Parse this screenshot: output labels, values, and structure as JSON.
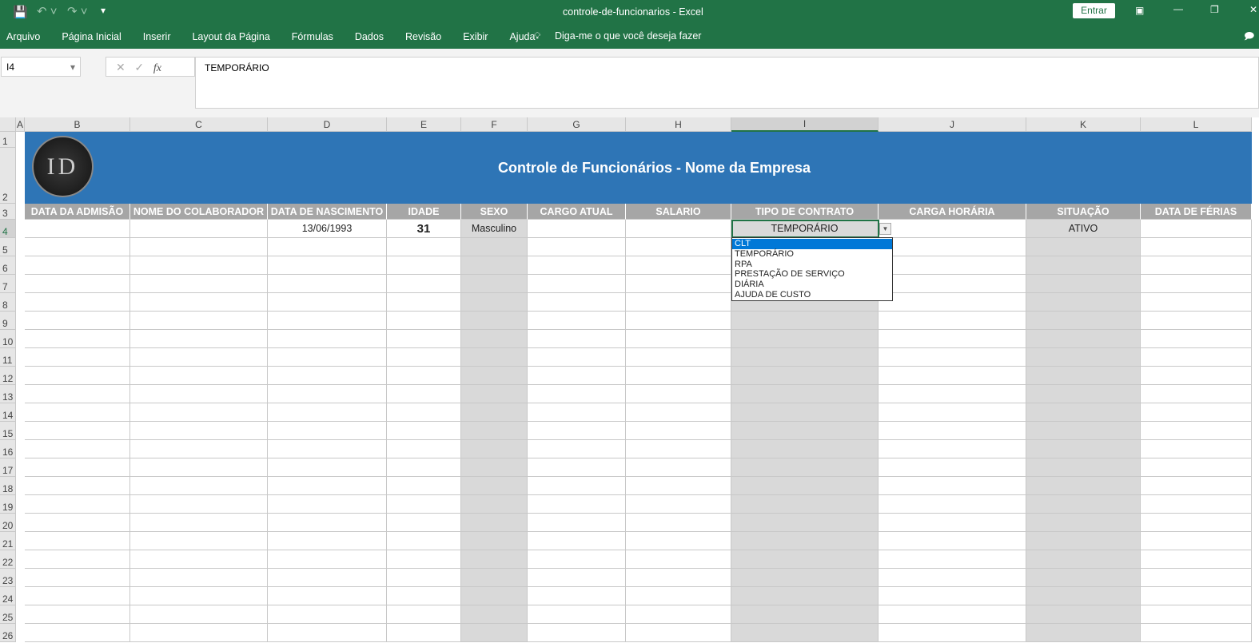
{
  "window": {
    "title": "controle-de-funcionarios  -  Excel",
    "signin": "Entrar"
  },
  "menu": [
    "Arquivo",
    "Página Inicial",
    "Inserir",
    "Layout da Página",
    "Fórmulas",
    "Dados",
    "Revisão",
    "Exibir",
    "Ajuda"
  ],
  "tell_me": "Diga-me o que você deseja fazer",
  "name_box": "I4",
  "formula": "TEMPORÁRIO",
  "columns": [
    "A",
    "B",
    "C",
    "D",
    "E",
    "F",
    "G",
    "H",
    "I",
    "J",
    "K",
    "L"
  ],
  "rows": [
    "1",
    "2",
    "3",
    "4",
    "5",
    "6",
    "7",
    "8",
    "9",
    "10",
    "11",
    "12",
    "13",
    "14",
    "15",
    "16",
    "17",
    "18",
    "19",
    "20",
    "21",
    "22",
    "23",
    "24",
    "25",
    "26"
  ],
  "banner": {
    "title": "Controle de Funcionários - Nome da Empresa",
    "logo": "ID"
  },
  "headers": [
    "DATA DA ADMISÃO",
    "NOME DO COLABORADOR",
    "DATA DE NASCIMENTO",
    "IDADE",
    "SEXO",
    "CARGO ATUAL",
    "SALARIO",
    "TIPO DE CONTRATO",
    "CARGA HORÁRIA",
    "SITUAÇÃO",
    "DATA DE FÉRIAS"
  ],
  "row4": {
    "D": "13/06/1993",
    "E": "31",
    "F": "Masculino",
    "I": "TEMPORÁRIO",
    "K": "ATIVO"
  },
  "dropdown": {
    "options": [
      "CLT",
      "TEMPORÁRIO",
      "RPA",
      "PRESTAÇÃO DE SERVIÇO",
      "DIÁRIA",
      "AJUDA DE CUSTO"
    ],
    "highlighted": "CLT"
  },
  "colors": {
    "green": "#217346",
    "banner": "#2e75b6",
    "header": "#a6a6a6",
    "fill": "#d9d9d9"
  }
}
